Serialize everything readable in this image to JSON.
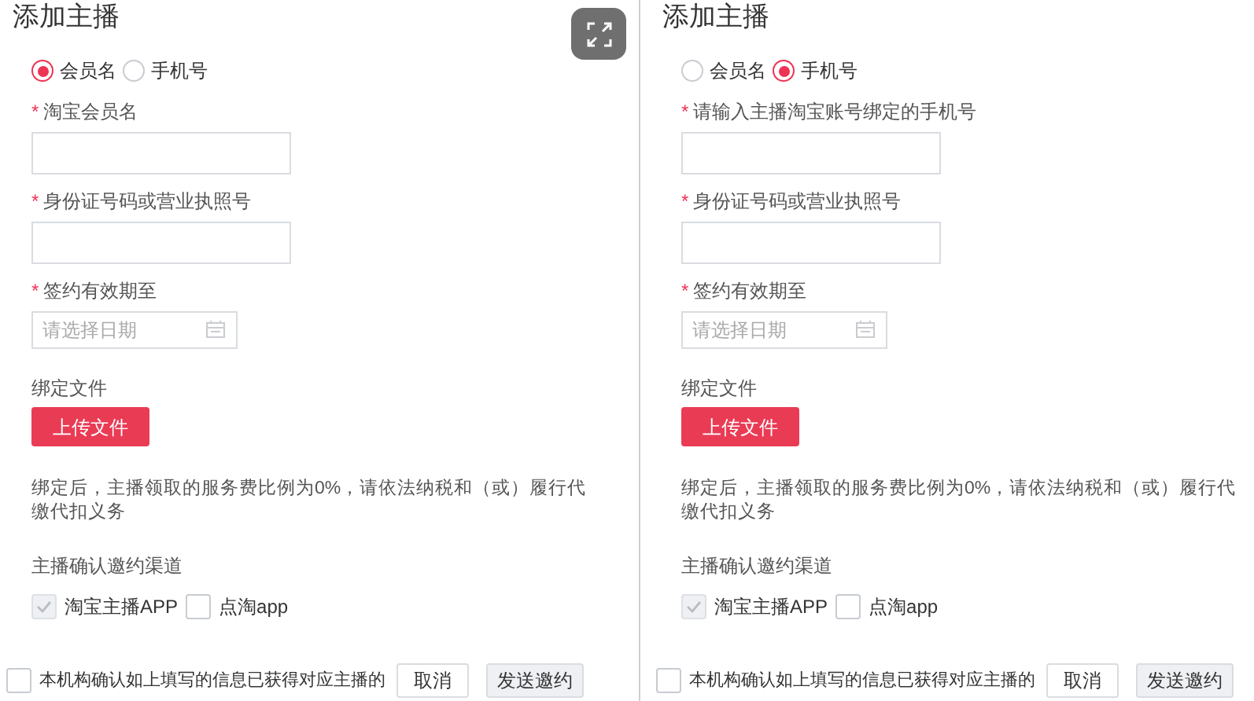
{
  "panels": [
    {
      "title": "添加主播",
      "expand_button": true,
      "radios": [
        {
          "label": "会员名",
          "selected": true
        },
        {
          "label": "手机号",
          "selected": false
        }
      ],
      "fields": [
        {
          "kind": "text",
          "label": "淘宝会员名",
          "required_mark": "*"
        },
        {
          "kind": "text",
          "label": "身份证号码或营业执照号",
          "required_mark": "*"
        },
        {
          "kind": "date",
          "label": "签约有效期至",
          "required_mark": "*",
          "placeholder": "请选择日期"
        }
      ],
      "file_label": "绑定文件",
      "upload_button": "上传文件",
      "notice": "绑定后，主播领取的服务费比例为0%，请依法纳税和（或）履行代缴代扣义务",
      "channel_label": "主播确认邀约渠道",
      "channels": [
        {
          "label": "淘宝主播APP",
          "checked": true,
          "disabled": true
        },
        {
          "label": "点淘app",
          "checked": false,
          "disabled": false
        }
      ],
      "agreement": {
        "text": "本机构确认如上填写的信息已获得对应主播的",
        "checked": false
      },
      "cancel_button": "取消",
      "send_button": "发送邀约"
    },
    {
      "title": "添加主播",
      "radios": [
        {
          "label": "会员名",
          "selected": false
        },
        {
          "label": "手机号",
          "selected": true
        }
      ],
      "fields": [
        {
          "kind": "text",
          "label": "请输入主播淘宝账号绑定的手机号",
          "required_mark": "*"
        },
        {
          "kind": "text",
          "label": "身份证号码或营业执照号",
          "required_mark": "*"
        },
        {
          "kind": "date",
          "label": "签约有效期至",
          "required_mark": "*",
          "placeholder": "请选择日期"
        }
      ],
      "file_label": "绑定文件",
      "upload_button": "上传文件",
      "notice": "绑定后，主播领取的服务费比例为0%，请依法纳税和（或）履行代缴代扣义务",
      "channel_label": "主播确认邀约渠道",
      "channels": [
        {
          "label": "淘宝主播APP",
          "checked": true,
          "disabled": true
        },
        {
          "label": "点淘app",
          "checked": false,
          "disabled": false
        }
      ],
      "agreement": {
        "text": "本机构确认如上填写的信息已获得对应主播的",
        "checked": false
      },
      "cancel_button": "取消",
      "send_button": "发送邀约"
    }
  ]
}
